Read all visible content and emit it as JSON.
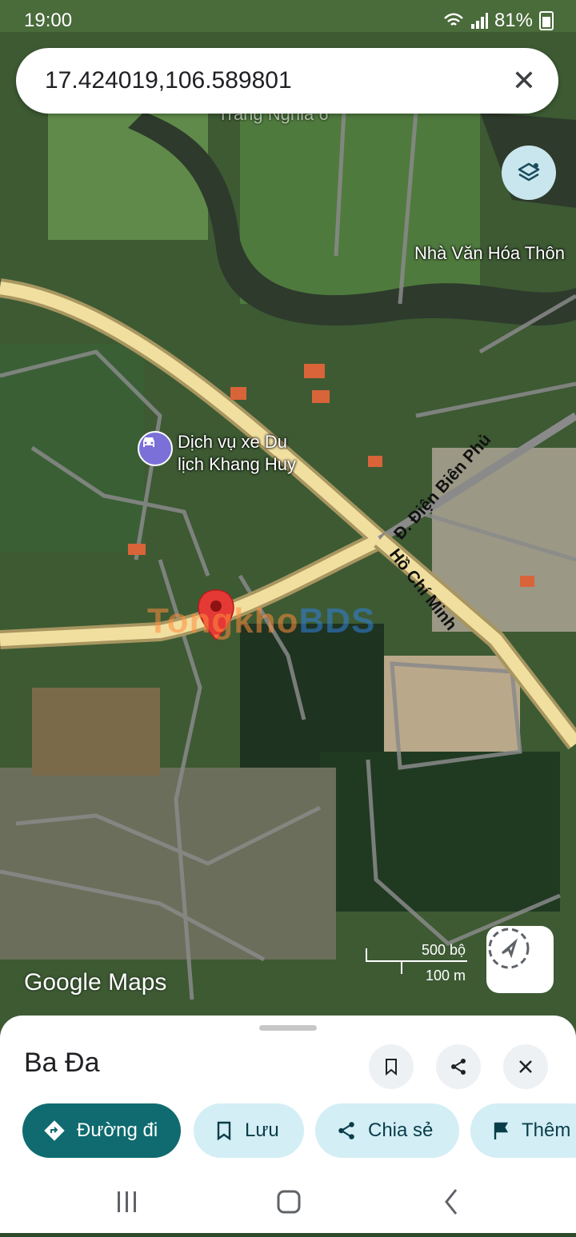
{
  "status_bar": {
    "time": "19:00",
    "battery": "81%"
  },
  "search": {
    "query": "17.424019,106.589801"
  },
  "map": {
    "labels": {
      "top_faded": "Trang Nghia 6",
      "culture_house": "Nhà Văn Hóa Thôn",
      "poi_line1": "Dịch vụ xe Du",
      "poi_line2": "lịch Khang Huy",
      "road_dbp": "Đ. Điện Biên Phủ",
      "road_hcm": "Hồ Chí Minh"
    },
    "watermark": {
      "part1": "Tongkho",
      "part2": "BDS"
    },
    "scale": {
      "imperial": "500 bộ",
      "metric": "100 m"
    },
    "attribution": "Google Maps"
  },
  "place_sheet": {
    "name": "Ba Đa",
    "actions": {
      "directions": "Đường đi",
      "save": "Lưu",
      "share": "Chia sẻ",
      "more": "Thêm"
    }
  },
  "colors": {
    "primary": "#0f6b6f",
    "chip_bg": "#d3eef5",
    "pin": "#e53935",
    "road": "#f1dfa0"
  }
}
